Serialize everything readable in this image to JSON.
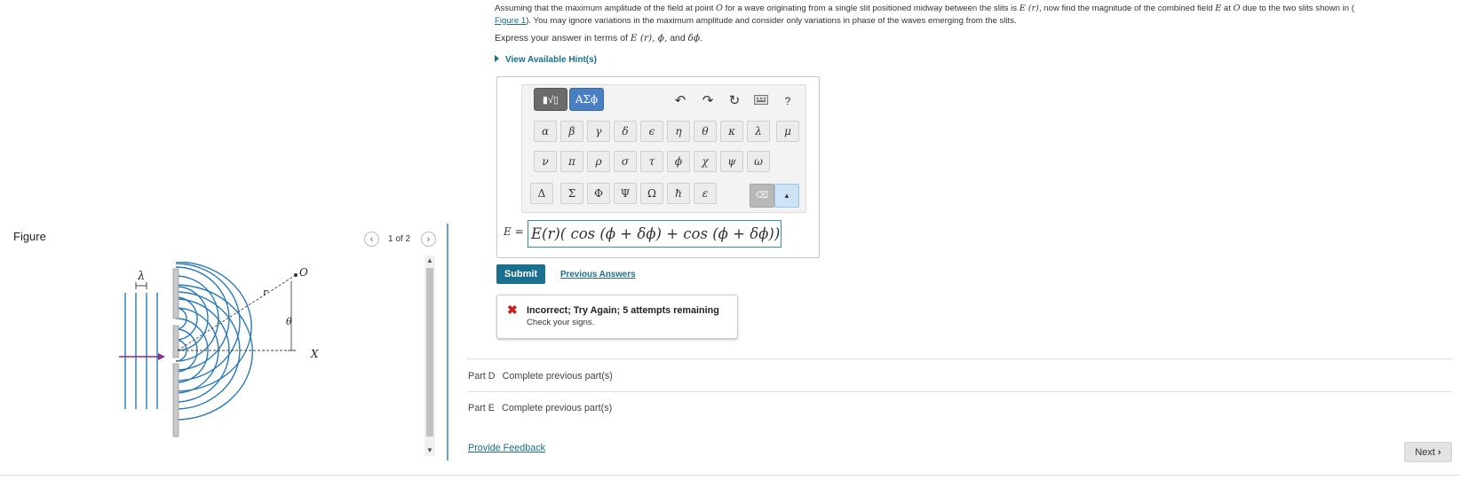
{
  "figure_panel": {
    "title": "Figure",
    "pager": "1 of 2",
    "prev_icon": "chevron-left-icon",
    "next_icon": "chevron-right-icon",
    "diagram_labels": {
      "lambda": "λ",
      "r": "r",
      "o": "O",
      "theta": "θ",
      "x": "X"
    }
  },
  "question": {
    "text_1": "Assuming that the maximum amplitude of the field at point ",
    "var_o": "O",
    "text_2": " for a wave originating from a single slit positioned midway between the slits is ",
    "var_er": "E (r)",
    "text_3": ", now find the magnitude of the combined field ",
    "var_e": "E",
    "text_4": " at ",
    "var_o2": "O",
    "text_5": " due to the two slits shown in (",
    "figure_link": "Figure 1",
    "text_6": "). You may ignore variations in the maximum amplitude and consider only variations in phase of the waves emerging from the slits.",
    "express_prefix": "Express your answer in terms of ",
    "express_vars": "E (r), ϕ,",
    "express_and": " and ",
    "express_last": "δϕ",
    "express_end": "."
  },
  "hints": {
    "label": "View Available Hint(s)"
  },
  "palette": {
    "template_button": "▮√▯",
    "greek_button": "ΑΣϕ",
    "tools": [
      "undo-icon",
      "redo-icon",
      "reset-icon",
      "keyboard-icon",
      "help-icon"
    ],
    "help_label": "?",
    "row1": [
      "α",
      "β",
      "γ",
      "δ",
      "ϵ",
      "η",
      "θ",
      "κ",
      "λ",
      "μ"
    ],
    "row2": [
      "ν",
      "π",
      "ρ",
      "σ",
      "τ",
      "ϕ",
      "χ",
      "ψ",
      "ω"
    ],
    "row3": [
      "Δ",
      "Σ",
      "Φ",
      "Ψ",
      "Ω",
      "ħ",
      "ε"
    ],
    "backspace_label": "⌫",
    "keyboard_toggle_label": "▲"
  },
  "answer": {
    "label": "E =",
    "value": "E(r)( cos (ϕ + δϕ) +  cos (ϕ + δϕ))"
  },
  "actions": {
    "submit": "Submit",
    "previous_answers": "Previous Answers"
  },
  "feedback": {
    "icon": "✖",
    "title": "Incorrect; Try Again; 5 attempts remaining",
    "subtitle": "Check your signs."
  },
  "parts": [
    {
      "name": "Part D",
      "status": "Complete previous part(s)"
    },
    {
      "name": "Part E",
      "status": "Complete previous part(s)"
    }
  ],
  "footer": {
    "provide_feedback": "Provide Feedback",
    "next": "Next"
  }
}
